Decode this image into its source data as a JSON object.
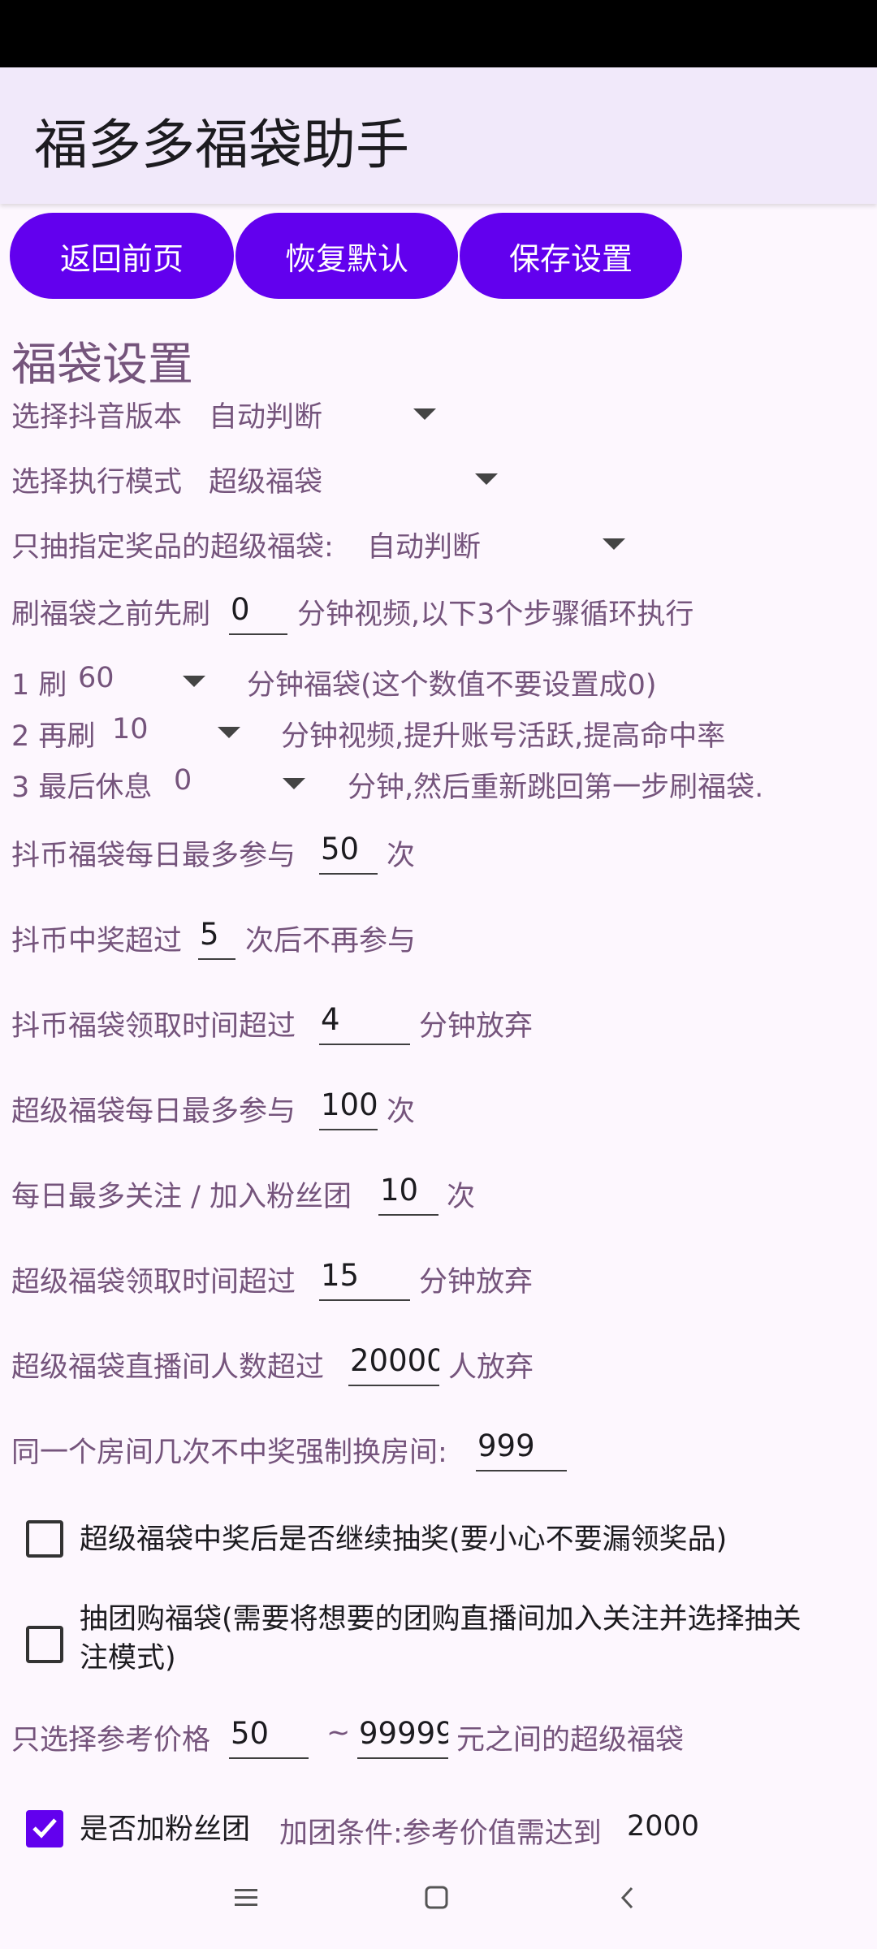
{
  "app": {
    "title": "福多多福袋助手"
  },
  "toolbar": {
    "back": "返回前页",
    "reset": "恢复默认",
    "save": "保存设置"
  },
  "section": {
    "title": "福袋设置"
  },
  "version": {
    "label": "选择抖音版本",
    "value": "自动判断"
  },
  "mode": {
    "label": "选择执行模式",
    "value": "超级福袋"
  },
  "prize": {
    "label": "只抽指定奖品的超级福袋:",
    "value": "自动判断"
  },
  "prewatch": {
    "pre": "刷福袋之前先刷",
    "value": "0",
    "post": "分钟视频,以下3个步骤循环执行"
  },
  "step1": {
    "pre": "1 刷",
    "value": "60",
    "post": "分钟福袋(这个数值不要设置成0)"
  },
  "step2": {
    "pre": "2 再刷",
    "value": "10",
    "post": "分钟视频,提升账号活跃,提高命中率"
  },
  "step3": {
    "pre": "3 最后休息",
    "value": "0",
    "post": "分钟,然后重新跳回第一步刷福袋."
  },
  "coin_daily": {
    "pre": "抖币福袋每日最多参与",
    "value": "50",
    "post": "次"
  },
  "coin_win": {
    "pre": "抖币中奖超过",
    "value": "5",
    "post": "次后不再参与"
  },
  "coin_time": {
    "pre": "抖币福袋领取时间超过",
    "value": "4",
    "post": "分钟放弃"
  },
  "super_daily": {
    "pre": "超级福袋每日最多参与",
    "value": "100",
    "post": "次"
  },
  "follow_daily": {
    "pre": "每日最多关注 / 加入粉丝团",
    "value": "10",
    "post": "次"
  },
  "super_time": {
    "pre": "超级福袋领取时间超过",
    "value": "15",
    "post": "分钟放弃"
  },
  "super_viewers": {
    "pre": "超级福袋直播间人数超过",
    "value": "20000",
    "post": "人放弃"
  },
  "room_switch": {
    "pre": "同一个房间几次不中奖强制换房间:",
    "value": "999"
  },
  "continue_after_win": {
    "label": "超级福袋中奖后是否继续抽奖(要小心不要漏领奖品)",
    "checked": false
  },
  "group_buy": {
    "line1": "抽团购福袋(需要将想要的团购直播间加入关注并选择抽关",
    "line2": "注模式)",
    "checked": false
  },
  "price_range": {
    "pre": "只选择参考价格",
    "min": "50",
    "sep": "~",
    "max": "99999",
    "post": "元之间的超级福袋"
  },
  "fan_club": {
    "label": "是否加粉丝团",
    "cond": "加团条件:参考价值需达到",
    "value": "2000",
    "checked": true
  },
  "colors": {
    "accent": "#6200ee",
    "label": "#75547c",
    "appbar": "#f1e9fa"
  },
  "icons": {
    "nav_menu": "menu-icon",
    "nav_home": "home-square-icon",
    "nav_back": "back-chevron-icon"
  }
}
